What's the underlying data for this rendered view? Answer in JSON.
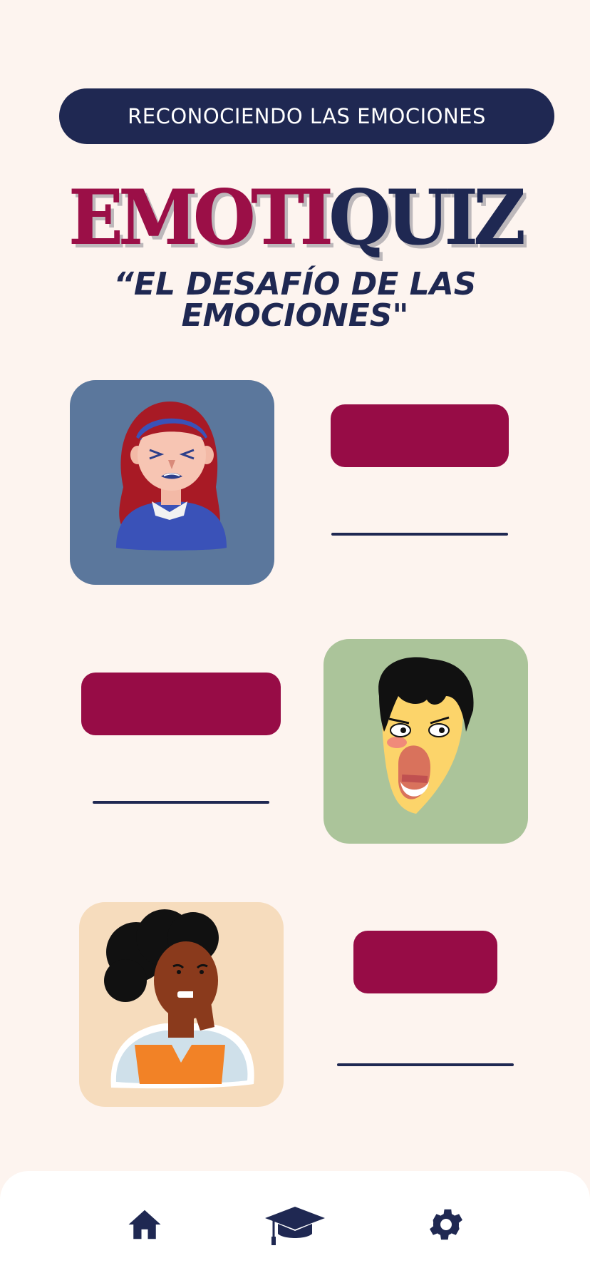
{
  "header": {
    "banner_text": "RECONOCIENDO LAS EMOCIONES",
    "logo_part1": "EMOTI",
    "logo_part2": "QUIZ",
    "subtitle_line1": "“EL DESAFÍO DE LAS",
    "subtitle_line2": "EMOCIONES\""
  },
  "quiz": {
    "items": [
      {
        "image": "girl-disgusted-illustration",
        "card_color": "#5b779c"
      },
      {
        "image": "boy-surprised-illustration",
        "card_color": "#abc49a"
      },
      {
        "image": "woman-nervous-illustration",
        "card_color": "#f6dcbd"
      }
    ],
    "answer_button_color": "#970c46"
  },
  "nav": {
    "items": [
      {
        "icon": "home-icon"
      },
      {
        "icon": "graduation-cap-icon"
      },
      {
        "icon": "gear-icon"
      }
    ]
  },
  "colors": {
    "background": "#fdf4ef",
    "navy": "#1f2852",
    "crimson": "#970c46"
  }
}
